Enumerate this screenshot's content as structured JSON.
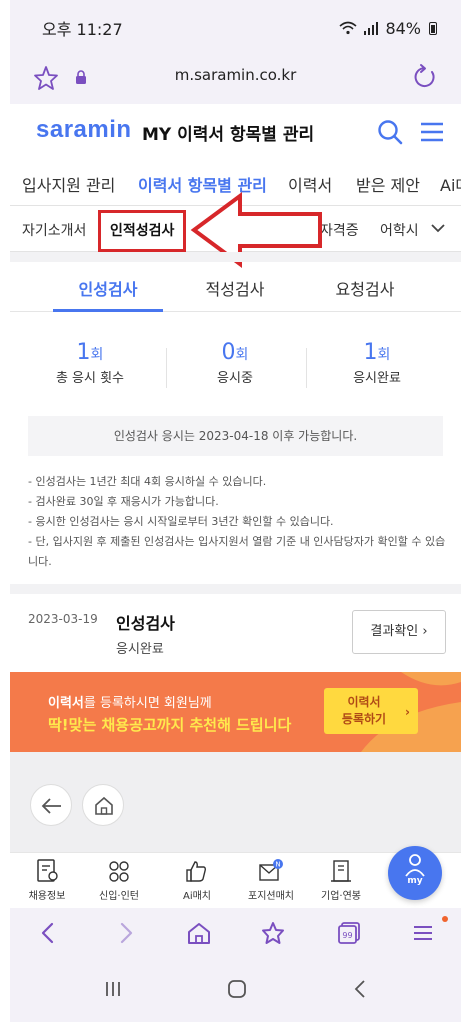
{
  "status_bar": {
    "time": "오후 11:27",
    "battery": "84%"
  },
  "browser": {
    "url": "m.saramin.co.kr"
  },
  "header": {
    "logo": "saramin",
    "title": "MY 이력서 항목별 관리"
  },
  "main_tabs": [
    "입사지원 관리",
    "이력서 항목별 관리",
    "이력서",
    "받은 제안",
    "Ai매"
  ],
  "sub_tabs": [
    "자기소개서",
    "인적성검사",
    "자격증",
    "어학시"
  ],
  "test_tabs": [
    "인성검사",
    "적성검사",
    "요청검사"
  ],
  "stats": [
    {
      "value": "1",
      "unit": "회",
      "label": "총 응시 횟수"
    },
    {
      "value": "0",
      "unit": "회",
      "label": "응시중"
    },
    {
      "value": "1",
      "unit": "회",
      "label": "응시완료"
    }
  ],
  "notice": "인성검사 응시는 2023-04-18 이후 가능합니다.",
  "bullets": [
    "- 인성검사는 1년간 최대 4회 응시하실 수 있습니다.",
    "- 검사완료 30일 후 재응시가 가능합니다.",
    "- 응시한 인성검사는 응시 시작일로부터 3년간 확인할 수 있습니다.",
    "- 단, 입사지원 후 제출된 인성검사는 입사지원서 열람 기준 내 인사담당자가 확인할 수 있습니다."
  ],
  "record": {
    "date": "2023-03-19",
    "name": "인성검사",
    "status": "응시완료",
    "button": "결과확인 ›"
  },
  "banner": {
    "line1_bold": "이력서",
    "line1_rest": "를 등록하시면 회원님께",
    "line2": "딱!맞는 채용공고까지 추천해 드립니다",
    "cta_line1": "이력서",
    "cta_line2": "등록하기"
  },
  "app_nav": [
    "채용정보",
    "신입·인턴",
    "Ai매치",
    "포지션매치",
    "기업·연봉"
  ],
  "fab": "my",
  "colors": {
    "brand": "#4876ef",
    "highlight": "#d7272a",
    "banner": "#f47a4a",
    "banner_text": "#ffe94d",
    "cta": "#ffd93f"
  }
}
